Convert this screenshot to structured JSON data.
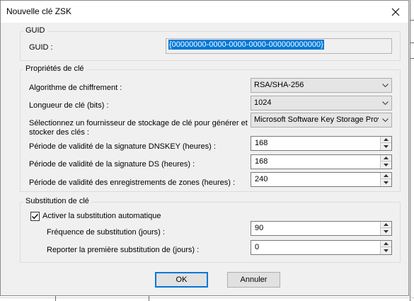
{
  "dialog": {
    "title": "Nouvelle clé ZSK"
  },
  "guid_group": {
    "legend": "GUID",
    "label": "GUID :",
    "value": "{00000000-0000-0000-0000-000000000000}"
  },
  "key_props": {
    "legend": "Propriétés de clé",
    "algorithm": {
      "label": "Algorithme de chiffrement :",
      "value": "RSA/SHA-256"
    },
    "key_length": {
      "label": "Longueur de clé (bits) :",
      "value": "1024"
    },
    "provider": {
      "label": "Sélectionnez un fournisseur de stockage de clé pour générer et stocker des clés :",
      "value": "Microsoft Software Key Storage Provider"
    },
    "dnskey_validity": {
      "label": "Période de validité de la signature DNSKEY (heures) :",
      "value": "168"
    },
    "ds_validity": {
      "label": "Période de validité de la signature DS (heures) :",
      "value": "168"
    },
    "zone_validity": {
      "label": "Période de validité des enregistrements de zones (heures) :",
      "value": "240"
    }
  },
  "rollover": {
    "legend": "Substitution de clé",
    "auto_label": "Activer la substitution automatique",
    "auto_checked": true,
    "frequency": {
      "label": "Fréquence de substitution (jours) :",
      "value": "90"
    },
    "delay": {
      "label": "Reporter la première substitution de (jours) :",
      "value": "0"
    }
  },
  "buttons": {
    "ok": "OK",
    "cancel": "Annuler"
  },
  "colors": {
    "accent": "#0078d7",
    "dialog_bg": "#f0f0f0"
  }
}
